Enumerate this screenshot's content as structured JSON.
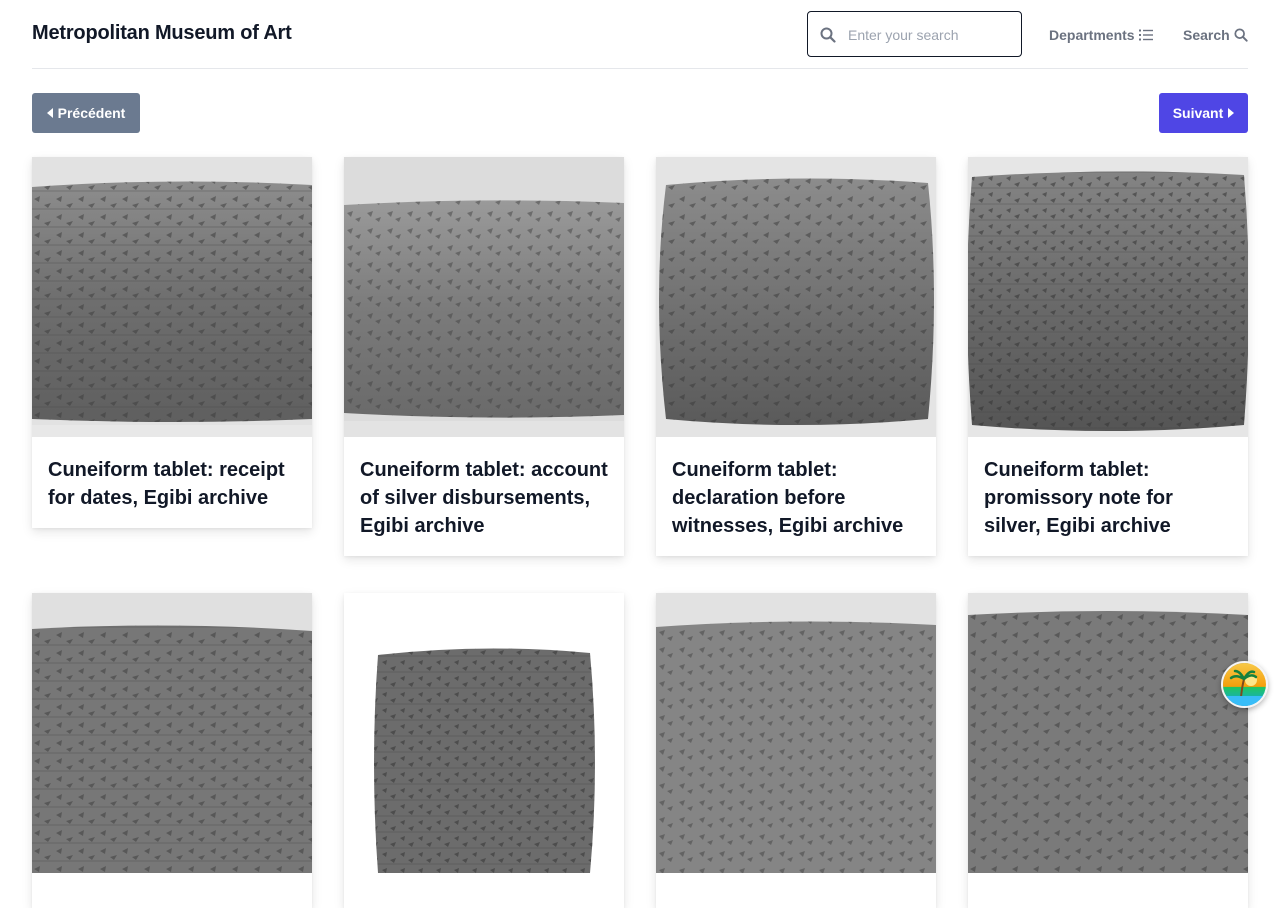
{
  "header": {
    "brand": "Metropolitan Museum of Art",
    "search_placeholder": "Enter your search",
    "search_value": "",
    "departments_label": "Departments",
    "search_label": "Search"
  },
  "pagination": {
    "prev_label": "Précédent",
    "next_label": "Suivant"
  },
  "cards": [
    {
      "title": "Cuneiform tablet: receipt for dates, Egibi archive"
    },
    {
      "title": "Cuneiform tablet: account of silver disbursements, Egibi archive"
    },
    {
      "title": "Cuneiform tablet: declaration before witnesses, Egibi archive"
    },
    {
      "title": "Cuneiform tablet: promissory note for silver, Egibi archive"
    },
    {
      "title": ""
    },
    {
      "title": ""
    },
    {
      "title": ""
    },
    {
      "title": ""
    }
  ],
  "colors": {
    "accent": "#4f46e5",
    "secondary_button": "#6b7a90",
    "nav_text": "#6b7280"
  },
  "icons": {
    "search_field": "search-icon",
    "departments": "list-icon",
    "search_link": "search-icon",
    "prev": "caret-left-icon",
    "next": "caret-right-icon",
    "badge": "palm-tree-sunset-icon"
  }
}
